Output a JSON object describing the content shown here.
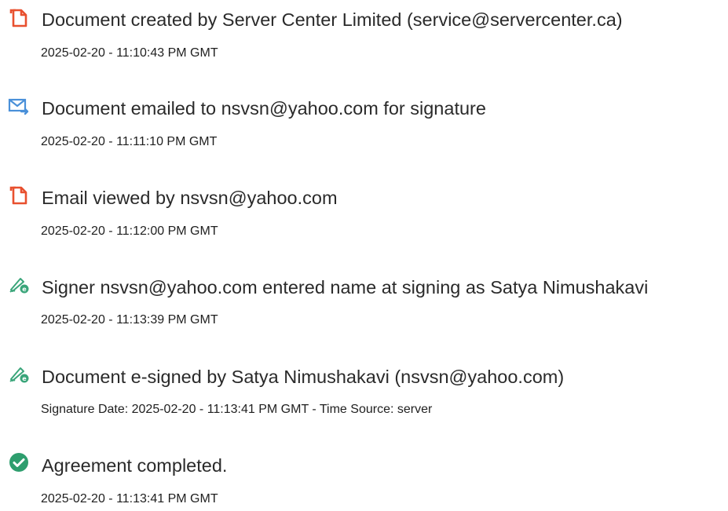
{
  "events": [
    {
      "icon": "document-created-icon",
      "title": "Document created by Server Center Limited (service@servercenter.ca)",
      "detail": "2025-02-20 - 11:10:43 PM GMT"
    },
    {
      "icon": "email-sent-icon",
      "title": "Document emailed to nsvsn@yahoo.com for signature",
      "detail": "2025-02-20 - 11:11:10 PM GMT"
    },
    {
      "icon": "document-viewed-icon",
      "title": "Email viewed by nsvsn@yahoo.com",
      "detail": "2025-02-20 - 11:12:00 PM GMT"
    },
    {
      "icon": "signer-pen-icon",
      "title": "Signer nsvsn@yahoo.com entered name at signing as Satya Nimushakavi",
      "detail": "2025-02-20 - 11:13:39 PM GMT"
    },
    {
      "icon": "esign-pen-icon",
      "title": "Document e-signed by Satya Nimushakavi (nsvsn@yahoo.com)",
      "detail": "Signature Date: 2025-02-20 - 11:13:41 PM GMT - Time Source: server"
    },
    {
      "icon": "completed-check-icon",
      "title": "Agreement completed.",
      "detail": "2025-02-20 - 11:13:41 PM GMT"
    }
  ],
  "colors": {
    "document_icon": "#e8502f",
    "email_icon": "#4a90d9",
    "pen_icon": "#3aa57a",
    "check_icon": "#2e9e6e",
    "text": "#2a2a2a"
  }
}
